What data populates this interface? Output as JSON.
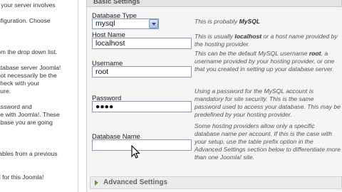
{
  "sidebar": {
    "lines": [
      "r your server involves",
      "",
      "nfiguration. Choose",
      "",
      "",
      "",
      "om the drop down list.",
      "",
      "atabase server Joomla!",
      "not necessarily be the",
      "check with your",
      "sure.",
      "",
      "assword and",
      "se with Joomla!. These",
      "abase you are going",
      "",
      "",
      "",
      "tables from a previous",
      "",
      "",
      "d for this Joomla!"
    ]
  },
  "section": {
    "title": "Basic Settings"
  },
  "form": {
    "db_type": {
      "label": "Database Type",
      "value": "mysql"
    },
    "host": {
      "label": "Host Name",
      "value": "localhost"
    },
    "username": {
      "label": "Username",
      "value": "root"
    },
    "password": {
      "label": "Password",
      "value": "●●●●"
    },
    "db_name": {
      "label": "Database Name",
      "value": ""
    }
  },
  "help": {
    "db_type": {
      "pre": "This is probably ",
      "bold": "MySQL"
    },
    "host": {
      "pre": "This is usually ",
      "bold": "localhost",
      "post": " or a host name provided by the hosting provider."
    },
    "username": {
      "pre": "This can be the default MySQL username ",
      "bold": "root",
      "post": ", a username provided by your hosting provider, or one that you created in setting up your database server."
    },
    "password": "Using a password for the MySQL account is mandatory for site security. This is the same password used to access your database. This may be predefined by your hosting provider.",
    "db_name": "Some hosting providers allow only a specific database name per account. If this is the case with your setup, use the table prefix option in the Advanced Settings section below to differentiate more than one Joomla! site."
  },
  "advanced": {
    "label": "Advanced Settings"
  }
}
